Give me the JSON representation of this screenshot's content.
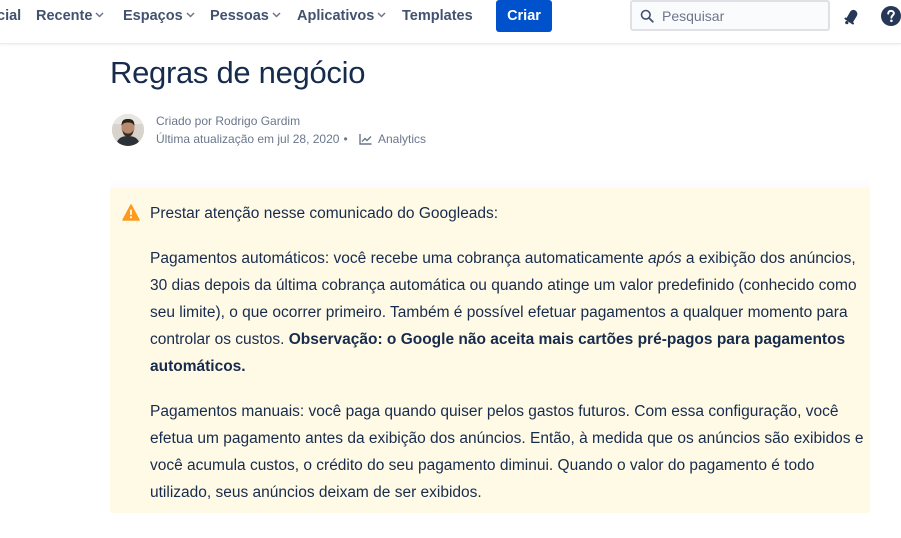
{
  "nav": {
    "items": [
      {
        "label": "cial",
        "has_chevron": false
      },
      {
        "label": "Recente",
        "has_chevron": true
      },
      {
        "label": "Espaços",
        "has_chevron": true
      },
      {
        "label": "Pessoas",
        "has_chevron": true
      },
      {
        "label": "Aplicativos",
        "has_chevron": true
      },
      {
        "label": "Templates",
        "has_chevron": false
      }
    ],
    "create_label": "Criar",
    "search_placeholder": "Pesquisar",
    "icons": {
      "search": "search-icon",
      "notifications": "bell-icon",
      "help": "help-icon",
      "chevron": "chevron-down-icon"
    },
    "colors": {
      "primary": "#0052cc",
      "nav_text": "#42526e"
    }
  },
  "page": {
    "title": "Regras de negócio",
    "byline": {
      "created_by": "Criado por Rodrigo Gardim",
      "updated": "Última atualização em jul 28, 2020",
      "separator": "•",
      "analytics_label": "Analytics"
    }
  },
  "panel": {
    "type": "warning",
    "background": "#fffae6",
    "icon_color": "#ff991f",
    "heading": "Prestar atenção nesse comunicado do Googleads:",
    "p1": {
      "text_before": "Pagamentos automáticos: você recebe uma cobrança automaticamente ",
      "italic": "após",
      "text_after": " a exibição dos anúncios, 30 dias depois da última cobrança automática ou quando atinge um valor predefinido (conhecido como seu limite), o que ocorrer primeiro. Também é possível efetuar pagamentos a qualquer momento para controlar os custos. ",
      "bold": "Observação: o Google não aceita mais cartões pré-pagos para pagamentos automáticos."
    },
    "p2": "Pagamentos manuais: você paga quando quiser pelos gastos futuros. Com essa configuração, você efetua um pagamento antes da exibição dos anúncios. Então, à medida que os anúncios são exibidos e você acumula custos, o crédito do seu pagamento diminui. Quando o valor do pagamento é todo utilizado, seus anúncios deixam de ser exibidos."
  }
}
